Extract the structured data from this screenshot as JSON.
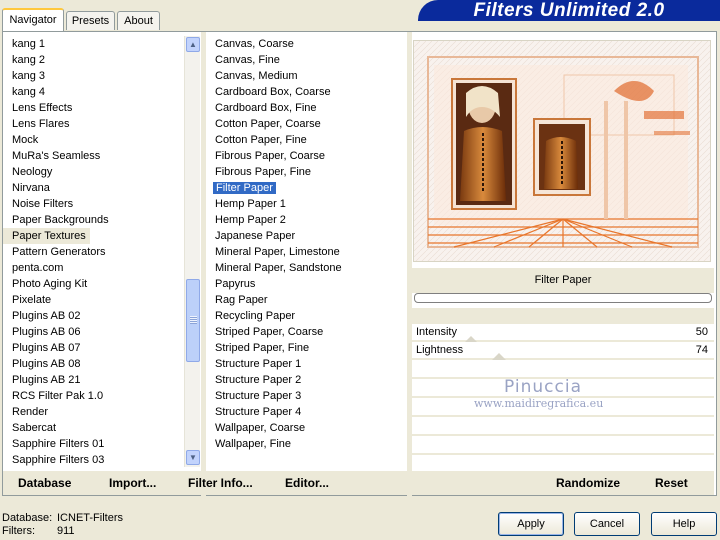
{
  "tabs": [
    {
      "label": "Navigator",
      "active": true
    },
    {
      "label": "Presets",
      "active": false
    },
    {
      "label": "About",
      "active": false
    }
  ],
  "banner": {
    "title": "Filters Unlimited 2.0"
  },
  "categories": [
    "kang 1",
    "kang 2",
    "kang 3",
    "kang 4",
    "Lens Effects",
    "Lens Flares",
    "Mock",
    "MuRa's Seamless",
    "Neology",
    "Nirvana",
    "Noise Filters",
    "Paper Backgrounds",
    "Paper Textures",
    "Pattern Generators",
    "penta.com",
    "Photo Aging Kit",
    "Pixelate",
    "Plugins AB 02",
    "Plugins AB 06",
    "Plugins AB 07",
    "Plugins AB 08",
    "Plugins AB 21",
    "RCS Filter Pak 1.0",
    "Render",
    "Sabercat",
    "Sapphire Filters 01",
    "Sapphire Filters 03"
  ],
  "selected_category": "Paper Textures",
  "filters": [
    "Canvas, Coarse",
    "Canvas, Fine",
    "Canvas, Medium",
    "Cardboard Box, Coarse",
    "Cardboard Box, Fine",
    "Cotton Paper, Coarse",
    "Cotton Paper, Fine",
    "Fibrous Paper, Coarse",
    "Fibrous Paper, Fine",
    "Filter Paper",
    "Hemp Paper 1",
    "Hemp Paper 2",
    "Japanese Paper",
    "Mineral Paper, Limestone",
    "Mineral Paper, Sandstone",
    "Papyrus",
    "Rag Paper",
    "Recycling Paper",
    "Striped Paper, Coarse",
    "Striped Paper, Fine",
    "Structure Paper 1",
    "Structure Paper 2",
    "Structure Paper 3",
    "Structure Paper 4",
    "Wallpaper, Coarse",
    "Wallpaper, Fine"
  ],
  "selected_filter": "Filter Paper",
  "preview": {
    "filter_name": "Filter Paper"
  },
  "params": [
    {
      "label": "Intensity",
      "value": "50"
    },
    {
      "label": "Lightness",
      "value": "74"
    }
  ],
  "watermark": {
    "name": "Pinuccia",
    "url": "www.maidiregrafica.eu"
  },
  "left_actions": {
    "database": "Database",
    "import": "Import...",
    "filter_info": "Filter Info...",
    "editor": "Editor..."
  },
  "right_actions": {
    "randomize": "Randomize",
    "reset": "Reset"
  },
  "status": {
    "database_label": "Database:",
    "database_value": "ICNET-Filters",
    "filters_label": "Filters:",
    "filters_value": "911"
  },
  "buttons": {
    "apply": "Apply",
    "cancel": "Cancel",
    "help": "Help"
  },
  "colors": {
    "selection": "#316ac5",
    "banner": "#0a2a9c",
    "preview_accent": "#e0701c"
  }
}
